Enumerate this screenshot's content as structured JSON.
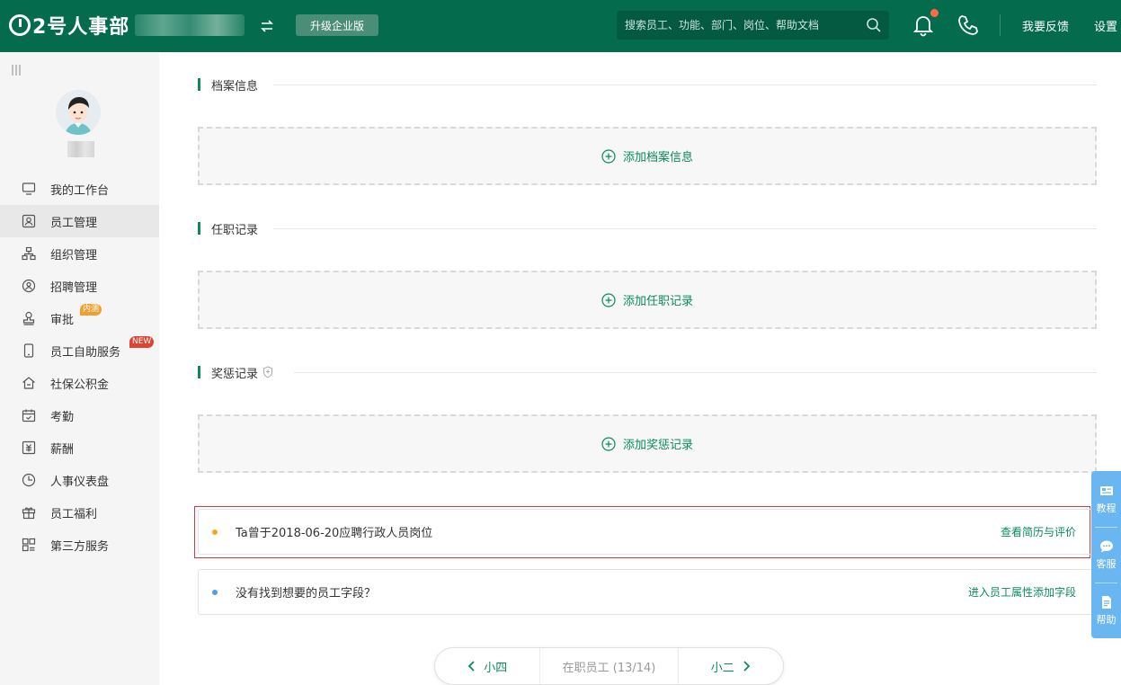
{
  "header": {
    "logo_text": "2号人事部",
    "upgrade_label": "升级企业版",
    "search_placeholder": "搜索员工、功能、部门、岗位、帮助文档",
    "feedback_label": "我要反馈",
    "settings_label": "设置"
  },
  "sidebar": {
    "items": [
      {
        "label": "我的工作台",
        "icon": "monitor-icon",
        "active": false
      },
      {
        "label": "员工管理",
        "icon": "user-card-icon",
        "active": true
      },
      {
        "label": "组织管理",
        "icon": "org-chart-icon",
        "active": false
      },
      {
        "label": "招聘管理",
        "icon": "recruit-icon",
        "active": false
      },
      {
        "label": "审批",
        "icon": "stamp-icon",
        "active": false,
        "badge": "内测"
      },
      {
        "label": "员工自助服务",
        "icon": "mobile-icon",
        "active": false,
        "badge": "NEW"
      },
      {
        "label": "社保公积金",
        "icon": "house-icon",
        "active": false
      },
      {
        "label": "考勤",
        "icon": "calendar-check-icon",
        "active": false
      },
      {
        "label": "薪酬",
        "icon": "salary-icon",
        "active": false
      },
      {
        "label": "人事仪表盘",
        "icon": "dashboard-icon",
        "active": false
      },
      {
        "label": "员工福利",
        "icon": "gift-icon",
        "active": false
      },
      {
        "label": "第三方服务",
        "icon": "apps-icon",
        "active": false
      }
    ]
  },
  "main": {
    "sections": [
      {
        "title": "档案信息",
        "add_label": "添加档案信息"
      },
      {
        "title": "任职记录",
        "add_label": "添加任职记录"
      },
      {
        "title": "奖惩记录",
        "add_label": "添加奖惩记录"
      }
    ],
    "info_rows": [
      {
        "text": "Ta曾于2018-06-20应聘行政人员岗位",
        "link": "查看简历与评价",
        "dot_color": "#f5a623"
      },
      {
        "text": "没有找到想要的员工字段？",
        "link": "进入员工属性添加字段",
        "dot_color": "#4a9fe8"
      }
    ]
  },
  "pager": {
    "prev_label": "小四",
    "status": "在职员工 (13/14)",
    "next_label": "小二"
  },
  "float_panel": {
    "items": [
      {
        "label": "教程",
        "icon": "video-card-icon"
      },
      {
        "label": "客服",
        "icon": "chat-icon"
      },
      {
        "label": "帮助",
        "icon": "document-icon"
      }
    ]
  },
  "colors": {
    "brand": "#046b4c",
    "accent": "#0a8a5e",
    "highlight_border": "#d9363e",
    "float_panel": "#6ab6f0"
  }
}
